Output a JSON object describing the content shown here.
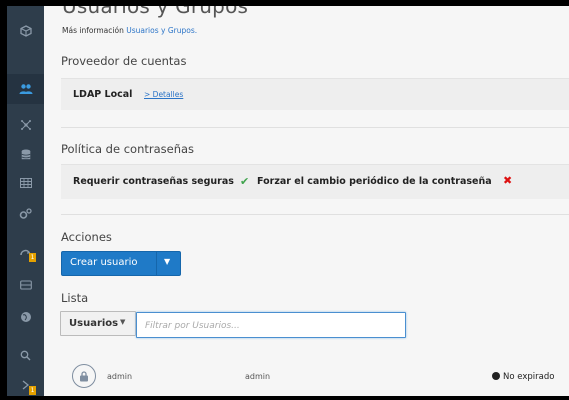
{
  "page": {
    "title": "Usuarios y Grupos",
    "info_prefix": "Más información",
    "info_link": "Usuarios y Grupos.",
    "accent_color": "#1f7ac7"
  },
  "sidebar": {
    "items": [
      {
        "icon": "cube-icon",
        "active": false
      },
      {
        "icon": "users-icon",
        "active": true
      },
      {
        "icon": "network-icon",
        "active": false
      },
      {
        "icon": "database-icon",
        "active": false
      },
      {
        "icon": "table-icon",
        "active": false
      },
      {
        "icon": "gears-icon",
        "active": false
      },
      {
        "icon": "update-icon",
        "active": false,
        "badge": "1"
      },
      {
        "icon": "storage-icon",
        "active": false
      },
      {
        "icon": "globe-icon",
        "active": false
      },
      {
        "icon": "search-icon",
        "active": false
      },
      {
        "icon": "arrow-icon",
        "active": false,
        "badge": "1"
      }
    ]
  },
  "accounts": {
    "heading": "Proveedor de cuentas",
    "provider": "LDAP Local",
    "details_link": "> Detalles"
  },
  "password_policy": {
    "heading": "Política de contraseñas",
    "strong_label": "Requerir contraseñas seguras",
    "strong_enabled": true,
    "periodic_label": "Forzar el cambio periódico de la contraseña",
    "periodic_enabled": false
  },
  "actions": {
    "heading": "Acciones",
    "create_label": "Crear usuario"
  },
  "list": {
    "heading": "Lista",
    "type_selected": "Usuarios",
    "filter_placeholder": "Filtrar por Usuarios...",
    "filter_value": "",
    "rows": [
      {
        "username": "admin",
        "full_name": "admin",
        "status": "No expirado"
      }
    ]
  }
}
